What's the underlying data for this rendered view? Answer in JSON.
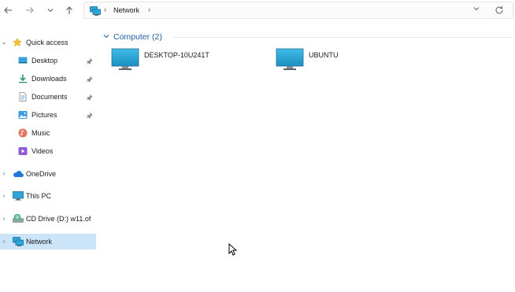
{
  "address_bar": {
    "path": [
      "Network"
    ]
  },
  "sidebar": {
    "items": [
      {
        "label": "Quick access",
        "icon": "star-icon"
      },
      {
        "label": "Desktop",
        "icon": "desktop-folder-icon",
        "pinned": true
      },
      {
        "label": "Downloads",
        "icon": "download-icon",
        "pinned": true
      },
      {
        "label": "Documents",
        "icon": "documents-icon",
        "pinned": true
      },
      {
        "label": "Pictures",
        "icon": "pictures-icon",
        "pinned": true
      },
      {
        "label": "Music",
        "icon": "music-icon"
      },
      {
        "label": "Videos",
        "icon": "videos-icon"
      },
      {
        "label": "OneDrive",
        "icon": "cloud-icon"
      },
      {
        "label": "This PC",
        "icon": "monitor-icon"
      },
      {
        "label": "CD Drive (D:) w11.of",
        "icon": "cd-drive-icon"
      },
      {
        "label": "Network",
        "icon": "network-icon",
        "selected": true
      }
    ]
  },
  "content": {
    "group": {
      "title": "Computer (2)",
      "items": [
        {
          "label": "DESKTOP-10U241T",
          "icon": "computer-icon"
        },
        {
          "label": "UBUNTU",
          "icon": "computer-icon"
        }
      ]
    }
  },
  "colors": {
    "accent": "#1f5fa8",
    "selection": "#cce4f7",
    "monitor_screen": "#2aa6d8"
  }
}
